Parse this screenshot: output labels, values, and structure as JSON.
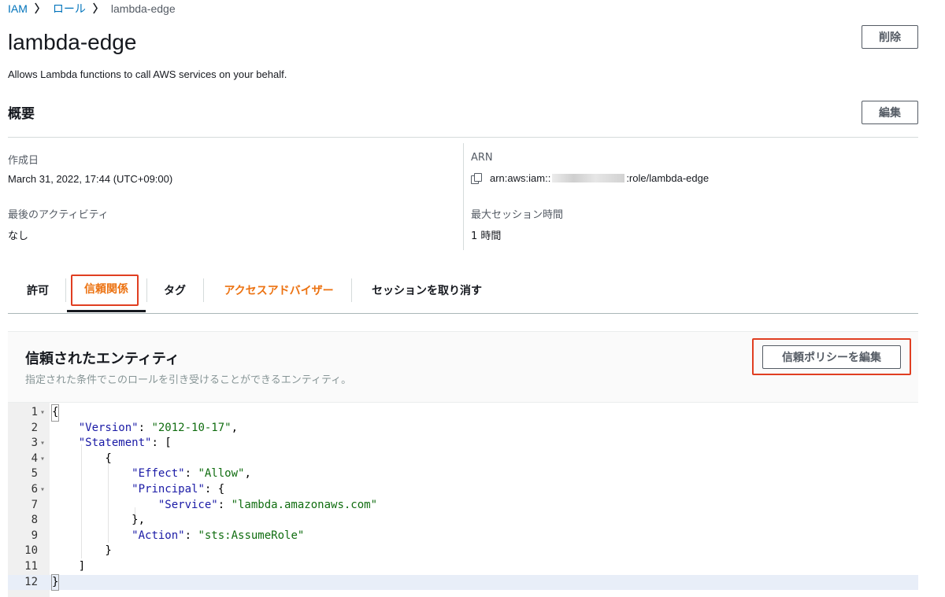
{
  "breadcrumb": {
    "root": "IAM",
    "parent": "ロール",
    "current": "lambda-edge",
    "sep": "〉"
  },
  "role": {
    "name": "lambda-edge",
    "description": "Allows Lambda functions to call AWS services on your behalf."
  },
  "buttons": {
    "delete": "削除",
    "edit": "編集",
    "edit_trust_policy": "信頼ポリシーを編集"
  },
  "summary": {
    "heading": "概要",
    "created_label": "作成日",
    "created_value": "March 31, 2022, 17:44 (UTC+09:00)",
    "last_activity_label": "最後のアクティビティ",
    "last_activity_value": "なし",
    "arn_label": "ARN",
    "arn_prefix": "arn:aws:iam::",
    "arn_suffix": ":role/lambda-edge",
    "max_session_label": "最大セッション時間",
    "max_session_value": "1 時間"
  },
  "tabs": [
    {
      "label": "許可",
      "active": false
    },
    {
      "label": "信頼関係",
      "active": true
    },
    {
      "label": "タグ",
      "active": false
    },
    {
      "label": "アクセスアドバイザー",
      "active": false
    },
    {
      "label": "セッションを取り消す",
      "active": false
    }
  ],
  "trusted_entities": {
    "title": "信頼されたエンティティ",
    "description": "指定された条件でこのロールを引き受けることができるエンティティ。"
  },
  "policy_lines": [
    {
      "n": "1",
      "text": "{"
    },
    {
      "n": "2",
      "text": "    \"Version\": \"2012-10-17\","
    },
    {
      "n": "3",
      "text": "    \"Statement\": ["
    },
    {
      "n": "4",
      "text": "        {"
    },
    {
      "n": "5",
      "text": "            \"Effect\": \"Allow\","
    },
    {
      "n": "6",
      "text": "            \"Principal\": {"
    },
    {
      "n": "7",
      "text": "                \"Service\": \"lambda.amazonaws.com\""
    },
    {
      "n": "8",
      "text": "            },"
    },
    {
      "n": "9",
      "text": "            \"Action\": \"sts:AssumeRole\""
    },
    {
      "n": "10",
      "text": "        }"
    },
    {
      "n": "11",
      "text": "    ]"
    },
    {
      "n": "12",
      "text": "}"
    }
  ],
  "colors": {
    "accent_orange": "#ec7211",
    "highlight_red": "#e03e21",
    "link_blue": "#0073bb"
  }
}
